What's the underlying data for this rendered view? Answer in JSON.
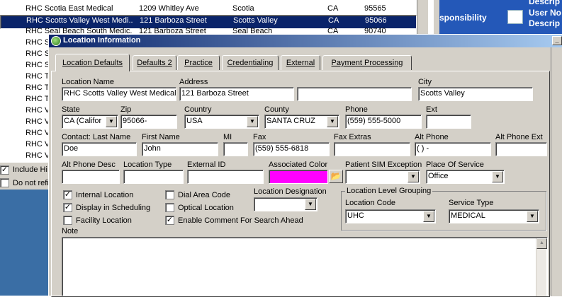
{
  "background_list": {
    "rows": [
      {
        "name": "RHC Scotia East Medical",
        "address": "1209 Whitley Ave",
        "city": "Scotia",
        "state": "CA",
        "zip": "95565"
      },
      {
        "name": "RHC Scotts Valley West Medi...",
        "address": "121 Barboza Street",
        "city": "Scotts Valley",
        "state": "CA",
        "zip": "95066"
      },
      {
        "name": "RHC Seal Beach South Medic...",
        "address": "121 Barboza Street",
        "city": "Seal Beach",
        "state": "CA",
        "zip": "90740"
      },
      {
        "name": "RHC S",
        "address": "",
        "city": "",
        "state": "",
        "zip": ""
      },
      {
        "name": "RHC S",
        "address": "",
        "city": "",
        "state": "",
        "zip": ""
      },
      {
        "name": "RHC S",
        "address": "",
        "city": "",
        "state": "",
        "zip": ""
      },
      {
        "name": "RHC T",
        "address": "",
        "city": "",
        "state": "",
        "zip": ""
      },
      {
        "name": "RHC T",
        "address": "",
        "city": "",
        "state": "",
        "zip": ""
      },
      {
        "name": "RHC T",
        "address": "",
        "city": "",
        "state": "",
        "zip": ""
      },
      {
        "name": "RHC V",
        "address": "",
        "city": "",
        "state": "",
        "zip": ""
      },
      {
        "name": "RHC V",
        "address": "",
        "city": "",
        "state": "",
        "zip": ""
      },
      {
        "name": "RHC V",
        "address": "",
        "city": "",
        "state": "",
        "zip": ""
      },
      {
        "name": "RHC V",
        "address": "",
        "city": "",
        "state": "",
        "zip": ""
      },
      {
        "name": "RHC V",
        "address": "",
        "city": "",
        "state": "",
        "zip": ""
      }
    ],
    "include_label": "Include Hi",
    "do_not_label": "Do not refi"
  },
  "right_panel": {
    "responsibility": "sponsibility",
    "user_line1": "Descrip",
    "user_line2": "User No",
    "user_line3": "Descrip"
  },
  "dialog": {
    "title": "Location Information",
    "minimize_glyph": "_",
    "tabs": [
      "Location Defaults",
      "Defaults 2",
      "Practice",
      "Credentialing",
      "External",
      "Payment Processing"
    ],
    "active_tab": "Location Defaults",
    "labels": {
      "location_name": "Location Name",
      "address": "Address",
      "city": "City",
      "state": "State",
      "zip": "Zip",
      "country": "Country",
      "county": "County",
      "phone": "Phone",
      "ext": "Ext",
      "contact_last": "Contact: Last Name",
      "first_name": "First Name",
      "mi": "MI",
      "fax": "Fax",
      "fax_extras": "Fax Extras",
      "alt_phone": "Alt Phone",
      "alt_phone_ext": "Alt Phone Ext",
      "alt_phone_desc": "Alt Phone Desc",
      "location_type": "Location Type",
      "external_id": "External ID",
      "associated_color": "Associated Color",
      "patient_sim": "Patient SIM Exception",
      "place_of_service": "Place Of Service",
      "location_designation": "Location Designation",
      "location_level_grouping": "Location Level Grouping",
      "location_code": "Location Code",
      "service_type": "Service Type",
      "note": "Note"
    },
    "values": {
      "location_name": "RHC Scotts Valley West Medical",
      "address1": "121 Barboza Street",
      "address2": "",
      "city": "Scotts Valley",
      "state": "CA  (Califor",
      "zip": "95066-",
      "country": "USA",
      "county": "SANTA CRUZ",
      "phone": "(559) 555-5000",
      "ext": "",
      "contact_last": "Doe",
      "first_name": "John",
      "mi": "",
      "fax": "(559) 555-6818",
      "fax_extras": "",
      "alt_phone": "(   )   -",
      "alt_phone_ext": "",
      "alt_phone_desc": "",
      "location_type": "",
      "external_id": "",
      "associated_color": "#ff00ff",
      "patient_sim": "",
      "place_of_service": "Office",
      "location_designation": "",
      "location_code": "UHC",
      "service_type": "MEDICAL",
      "note": ""
    },
    "checkboxes": [
      {
        "label": "Internal Location",
        "checked": true
      },
      {
        "label": "Display in Scheduling",
        "checked": true
      },
      {
        "label": "Facility Location",
        "checked": false
      },
      {
        "label": "Dial Area Code",
        "checked": false
      },
      {
        "label": "Optical Location",
        "checked": false
      },
      {
        "label": "Enable Comment For Search Ahead",
        "checked": true
      }
    ],
    "check_glyph": "✓",
    "dropdown_glyph": "▼",
    "scroll_up_glyph": "▲",
    "folder_glyph": "📂"
  }
}
